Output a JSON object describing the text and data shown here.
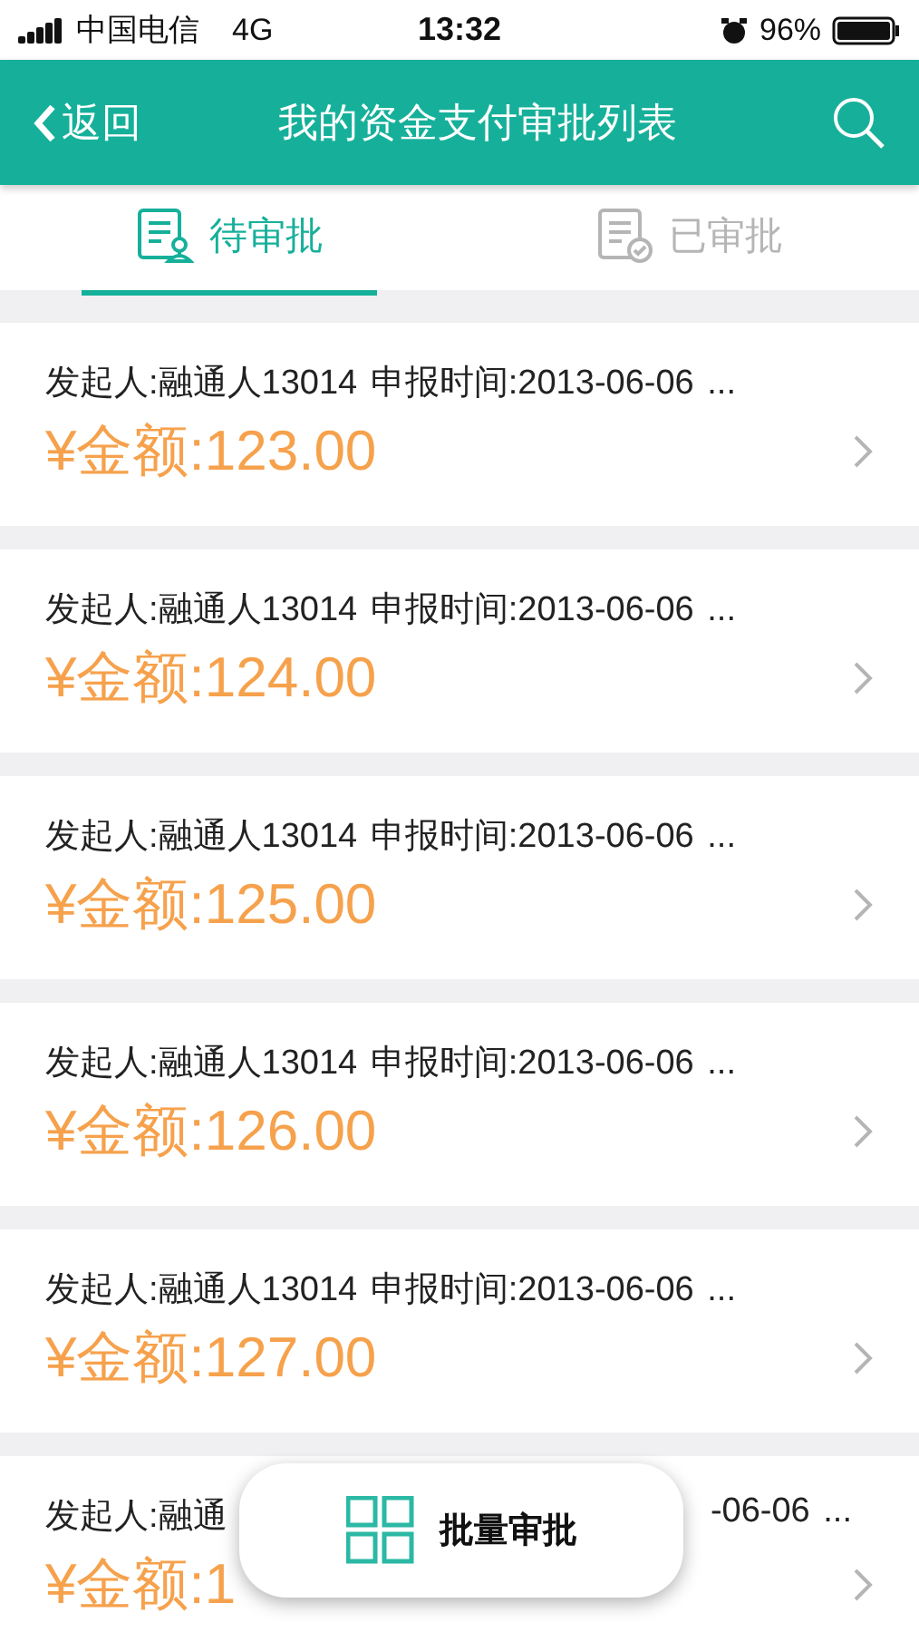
{
  "status_bar": {
    "carrier": "中国电信",
    "network": "4G",
    "time": "13:32",
    "battery": "96%"
  },
  "header": {
    "back": "返回",
    "title": "我的资金支付审批列表"
  },
  "tabs": [
    {
      "label": "待审批",
      "selected": true
    },
    {
      "label": "已审批",
      "selected": false
    }
  ],
  "items": [
    {
      "info": "发起人:融通人13014  申报时间:2013-06-06 ...",
      "amount": "¥金额:123.00"
    },
    {
      "info": "发起人:融通人13014  申报时间:2013-06-06 ...",
      "amount": "¥金额:124.00"
    },
    {
      "info": "发起人:融通人13014  申报时间:2013-06-06 ...",
      "amount": "¥金额:125.00"
    },
    {
      "info": "发起人:融通人13014  申报时间:2013-06-06 ...",
      "amount": "¥金额:126.00"
    },
    {
      "info": "发起人:融通人13014  申报时间:2013-06-06 ...",
      "amount": "¥金额:127.00"
    },
    {
      "kind": "covered",
      "info": "发起人:融通",
      "info_end": "-06-06 ...",
      "amount": "¥金额:1"
    }
  ],
  "batch_button": "批量审批"
}
